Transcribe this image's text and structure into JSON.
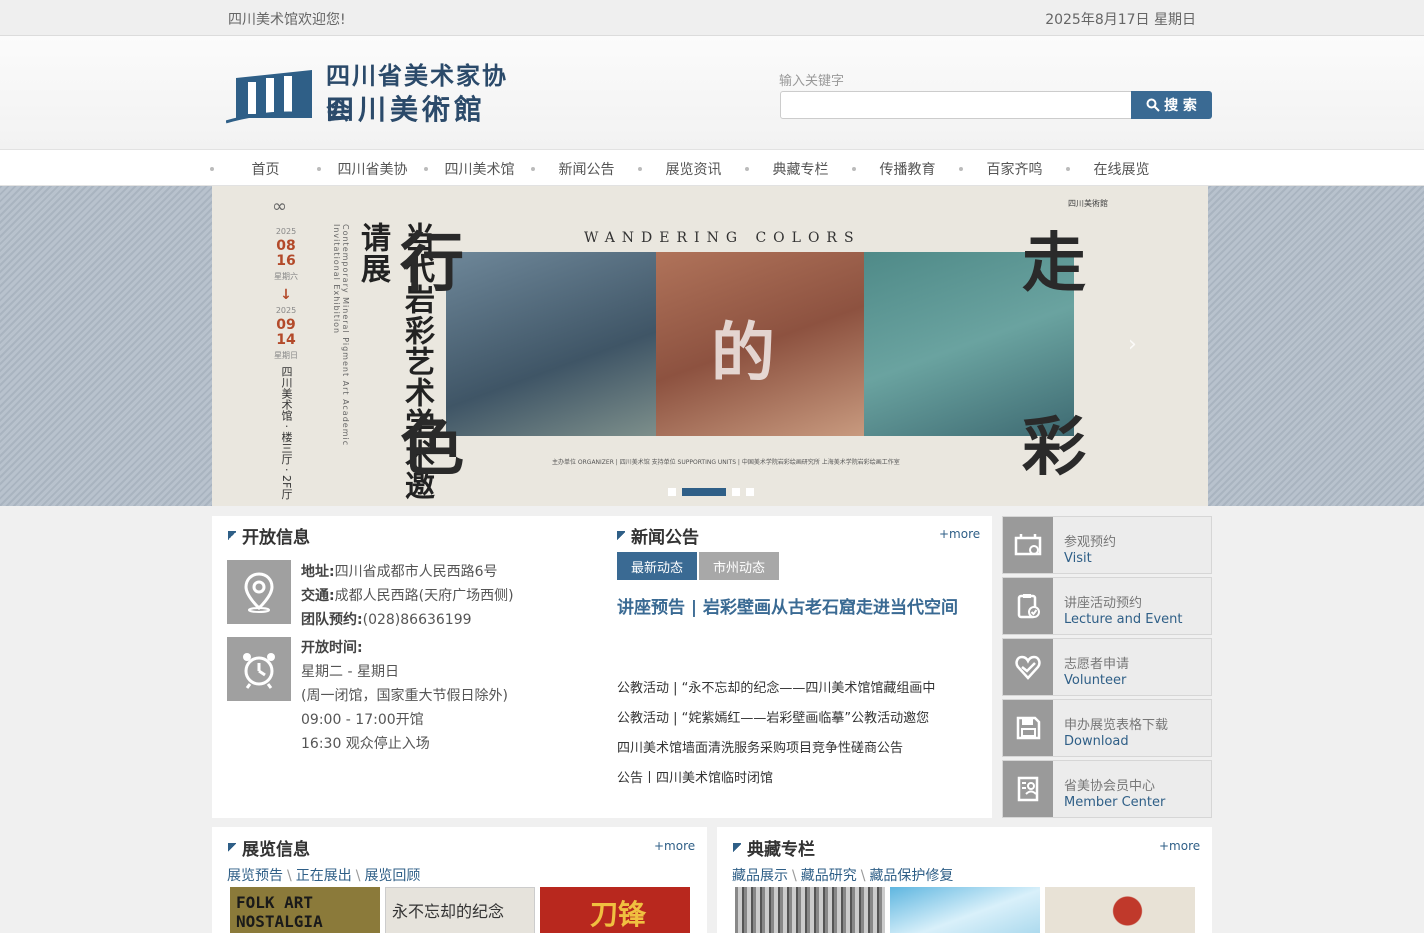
{
  "topbar": {
    "welcome": "四川美术馆欢迎您!",
    "date": "2025年8月17日 星期日"
  },
  "logo": {
    "line1": "四川省美术家协会",
    "line2": "四川美術館"
  },
  "search": {
    "label": "输入关键字",
    "placeholder": "",
    "button": "搜 索"
  },
  "nav": [
    "首页",
    "四川省美协",
    "四川美术馆",
    "新闻公告",
    "展览资讯",
    "典藏专栏",
    "传播教育",
    "百家齐鸣",
    "在线展览"
  ],
  "banner": {
    "title_vertical": "当代岩彩艺术学术邀请展",
    "subtitle_vertical": "Contemporary Mineral Pigment Art Academic Invitational Exhibition",
    "chars": [
      "行",
      "色",
      "走",
      "彩",
      "的"
    ],
    "english": "WANDERING COLORS",
    "date_start": [
      "2025",
      "08",
      "16",
      "星期六"
    ],
    "date_end": [
      "2025",
      "09",
      "14",
      "星期日"
    ],
    "venue": "四川美术馆 · 楼三厅 · 2F厅",
    "organizers": "主办单位 ORGANIZER | 四川美术馆    支持单位 SUPPORTING UNITS | 中国美术学院岩彩绘画研究所    上海美术学院岩彩绘画工作室",
    "arrow": "›"
  },
  "open_info": {
    "title": "开放信息",
    "address_label": "地址:",
    "address": "四川省成都市人民西路6号",
    "traffic_label": "交通:",
    "traffic": "成都人民西路(天府广场西侧)",
    "group_label": "团队预约:",
    "group": "(028)86636199",
    "hours_label": "开放时间:",
    "days": "星期二 - 星期日",
    "closed": "(周一闭馆，国家重大节假日除外)",
    "hours": "09:00 - 17:00开馆",
    "stop": "16:30 观众停止入场"
  },
  "news": {
    "title": "新闻公告",
    "more": "+more",
    "tabs": [
      "最新动态",
      "市州动态"
    ],
    "headline": "讲座预告 | 岩彩壁画从古老石窟走进当代空间",
    "items": [
      "公教活动 | “永不忘却的纪念——四川美术馆馆藏组画中",
      "公教活动 | “姹紫嫣红——岩彩壁画临摹”公教活动邀您",
      "四川美术馆墙面清洗服务采购项目竞争性磋商公告",
      "公告丨四川美术馆临时闭馆"
    ]
  },
  "services": [
    {
      "zh": "参观预约",
      "en": "Visit"
    },
    {
      "zh": "讲座活动预约",
      "en": "Lecture and Event"
    },
    {
      "zh": "志愿者申请",
      "en": "Volunteer"
    },
    {
      "zh": "申办展览表格下载",
      "en": "Download"
    },
    {
      "zh": "省美协会员中心",
      "en": "Member Center"
    }
  ],
  "exhibitions": {
    "title": "展览信息",
    "more": "+more",
    "links": [
      "展览预告",
      "正在展出",
      "展览回顾"
    ],
    "thumbs": [
      "FOLK ART NOSTALGIA",
      "永不忘却的纪念",
      "刀锋"
    ]
  },
  "collection": {
    "title": "典藏专栏",
    "more": "+more",
    "links": [
      "藏品展示",
      "藏品研究",
      "藏品保护修复"
    ]
  },
  "colors": {
    "accent": "#3a6a93",
    "nav_text": "#555555",
    "icon_bg": "#9a9a9a"
  },
  "icons": [
    "search-icon",
    "location-icon",
    "alarm-clock-icon",
    "visit-icon",
    "clipboard-check-icon",
    "heart-hand-icon",
    "floppy-disk-icon",
    "member-card-icon"
  ]
}
